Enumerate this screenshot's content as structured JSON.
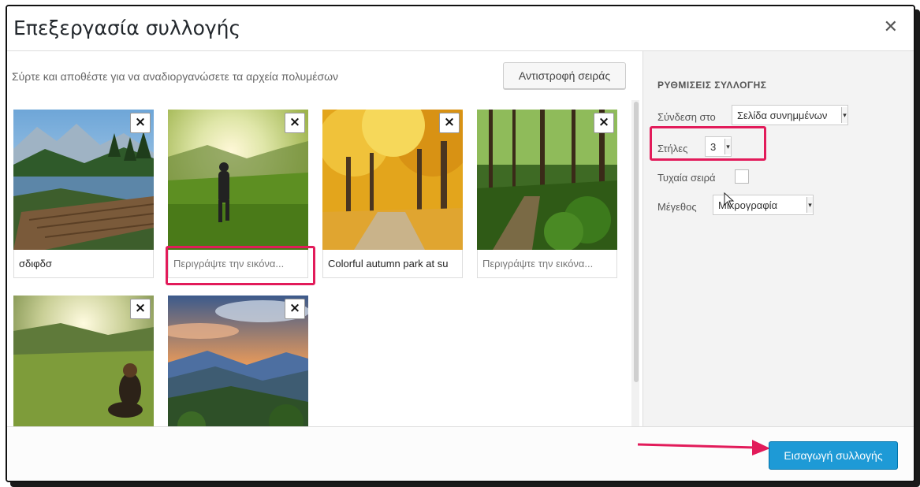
{
  "dialog": {
    "title": "Επεξεργασία συλλογής",
    "close_icon": "close-icon"
  },
  "gallery": {
    "instructions": "Σύρτε και αποθέστε για να αναδιοργανώσετε τα αρχεία πολυμέσων",
    "reverse_button": "Αντιστροφή σειράς",
    "items": [
      {
        "caption": "σδιφδσ",
        "placeholder": false,
        "image": "lake-dock-mountains"
      },
      {
        "caption": "Περιγράψτε την εικόνα...",
        "placeholder": true,
        "image": "man-walking-meadow-sunrise"
      },
      {
        "caption": "Colorful autumn park at su",
        "placeholder": false,
        "image": "autumn-park-yellow-trees"
      },
      {
        "caption": "Περιγράψτε την εικόνα...",
        "placeholder": true,
        "image": "green-forest-path"
      },
      {
        "caption": "",
        "placeholder": false,
        "image": "woman-sitting-grass-sunset"
      },
      {
        "caption": "",
        "placeholder": false,
        "image": "mountain-valley-sunset"
      }
    ],
    "remove_icon": "×"
  },
  "settings": {
    "title": "ΡΥΘΜΙΣΕΙΣ ΣΥΛΛΟΓΗΣ",
    "link_label": "Σύνδεση στο",
    "link_value": "Σελίδα συνημμένων",
    "columns_label": "Στήλες",
    "columns_value": "3",
    "random_label": "Τυχαία σειρά",
    "random_checked": false,
    "size_label": "Μέγεθος",
    "size_value": "Μικρογραφία"
  },
  "footer": {
    "insert_button": "Εισαγωγή συλλογής"
  },
  "colors": {
    "highlight": "#e21b5a",
    "primary_button": "#1e9ad6"
  }
}
